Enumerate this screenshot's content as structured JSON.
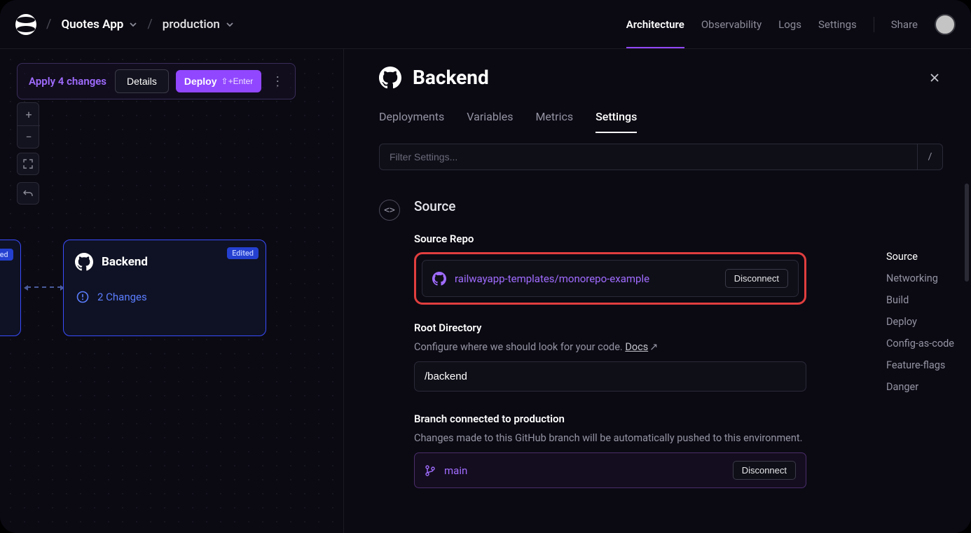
{
  "breadcrumb": {
    "project": "Quotes App",
    "environment": "production"
  },
  "nav": {
    "architecture": "Architecture",
    "observability": "Observability",
    "logs": "Logs",
    "settings": "Settings",
    "share": "Share"
  },
  "changebar": {
    "apply": "Apply 4 changes",
    "details": "Details",
    "deploy": "Deploy",
    "deploy_hint": "⇧+Enter"
  },
  "canvas": {
    "partial_badge": "dited",
    "node": {
      "title": "Backend",
      "badge": "Edited",
      "changes": "2 Changes"
    }
  },
  "panel": {
    "title": "Backend",
    "tabs": {
      "deployments": "Deployments",
      "variables": "Variables",
      "metrics": "Metrics",
      "settings": "Settings"
    },
    "filter_placeholder": "Filter Settings...",
    "filter_key": "/",
    "section_title": "Source",
    "source_repo_label": "Source Repo",
    "repo": "railwayapp-templates/monorepo-example",
    "disconnect": "Disconnect",
    "root_dir_label": "Root Directory",
    "root_dir_desc": "Configure where we should look for your code. ",
    "docs": "Docs",
    "root_dir_value": "/backend",
    "branch_label": "Branch connected to production",
    "branch_desc": "Changes made to this GitHub branch will be automatically pushed to this environment.",
    "branch_name": "main",
    "branch_disconnect": "Disconnect"
  },
  "toc": {
    "source": "Source",
    "networking": "Networking",
    "build": "Build",
    "deploy": "Deploy",
    "config": "Config-as-code",
    "flags": "Feature-flags",
    "danger": "Danger"
  }
}
